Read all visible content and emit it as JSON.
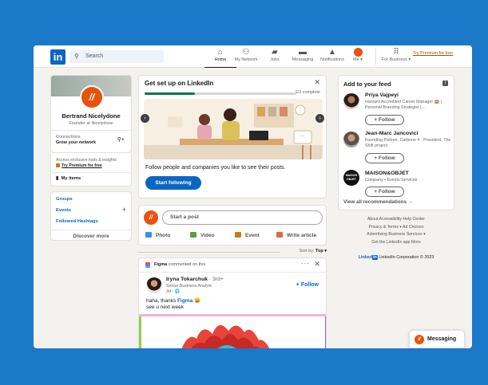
{
  "nav": {
    "search_placeholder": "Search",
    "items": [
      {
        "label": "Home",
        "icon": "home-icon"
      },
      {
        "label": "My Network",
        "icon": "network-icon"
      },
      {
        "label": "Jobs",
        "icon": "jobs-icon"
      },
      {
        "label": "Messaging",
        "icon": "messaging-icon"
      },
      {
        "label": "Notifications",
        "icon": "bell-icon"
      },
      {
        "label": "Me ▾",
        "icon": "avatar"
      },
      {
        "label": "For Business ▾",
        "icon": "grid-icon"
      }
    ],
    "premium_label": "Try Premium for free"
  },
  "profile": {
    "name": "Bertrand Nicelydone",
    "headline": "Founder at Nicelydone",
    "connections_label": "Connections",
    "connections_sub": "Grow your network",
    "premium_text": "Access exclusive tools & insights",
    "premium_link": "Try Premium for free",
    "my_items": "My items"
  },
  "groups": {
    "groups_label": "Groups",
    "events_label": "Events",
    "hashtags_label": "Followed Hashtags",
    "discover_label": "Discover more"
  },
  "setup": {
    "title": "Get set up on LinkedIn",
    "progress_text": "1/3 complete",
    "progress_fraction": 0.33,
    "body": "Follow people and companies you like to see their posts.",
    "button": "Start following"
  },
  "postbox": {
    "placeholder": "Start a post",
    "actions": [
      "Photo",
      "Video",
      "Event",
      "Write article"
    ]
  },
  "sort": {
    "label": "Sort by:",
    "value": "Top ▾"
  },
  "post": {
    "company": "Figma",
    "header_text": "commented on this",
    "author": "Iryna Tokarchuk",
    "degree": "· 3rd+",
    "author_title": "Senior Business Analyst",
    "time": "3d · 🌐",
    "follow": "+ Follow",
    "text_line1_prefix": "haha, thanks",
    "text_mention": "Figma",
    "text_line1_suffix": "😄",
    "text_line2": "see u next week"
  },
  "feed": {
    "title": "Add to your feed",
    "recommendations": [
      {
        "name": "Priya Vajpeyi",
        "sub": "Harvard Accredited Career Manager 🏫 | Personal Branding Strategist |...",
        "button": "+ Follow"
      },
      {
        "name": "Jean-Marc Jancovici",
        "sub": "Founding Partner, Carbone 4 - President, The Shift project",
        "button": "+ Follow"
      },
      {
        "name": "MAISON&OBJET",
        "sub": "Company • Events Services",
        "button": "+ Follow"
      }
    ],
    "view_all": "View all recommendations →"
  },
  "footer": {
    "line1": "About   Accessibility   Help Center",
    "line2": "Privacy & Terms ▾   Ad Choices",
    "line3": "Advertising   Business Services ▾",
    "line4": "Get the LinkedIn app   More",
    "brand_word": "Linked",
    "brand_in": "in",
    "copyright": "LinkedIn Corporation © 2023"
  },
  "messaging": {
    "label": "Messaging"
  },
  "colors": {
    "brand": "#0a66c2",
    "background": "#1c78c9",
    "avatar": "#e7530e",
    "progress": "#057642"
  }
}
